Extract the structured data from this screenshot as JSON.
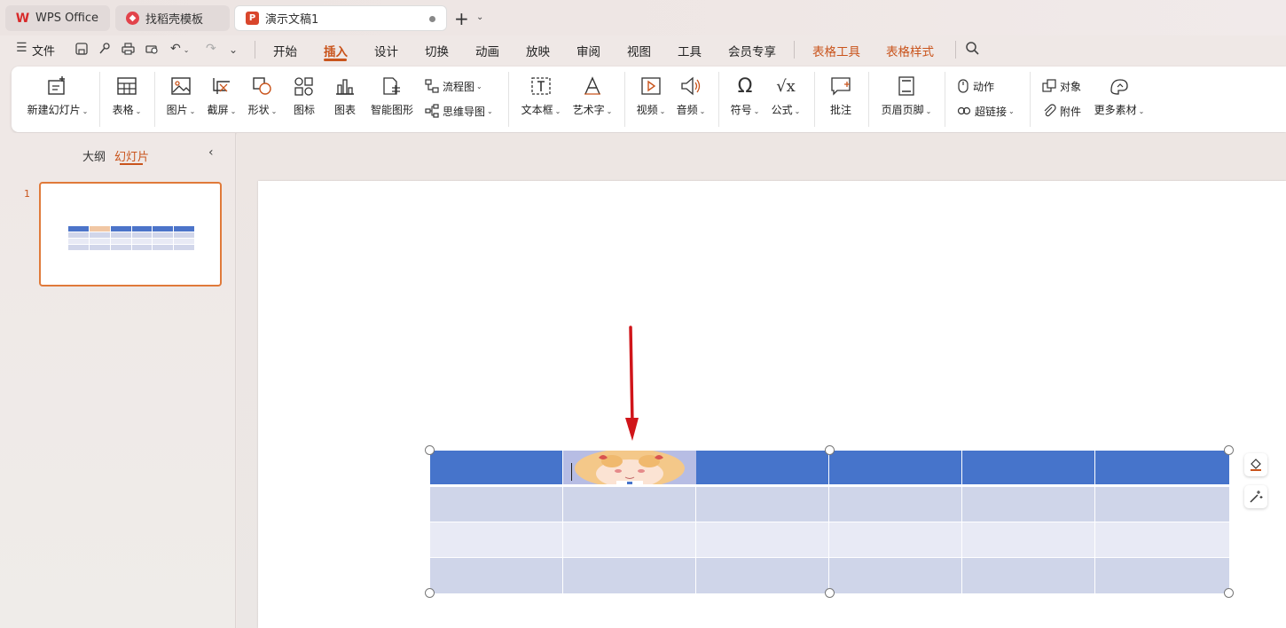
{
  "tabs": {
    "wps": "WPS Office",
    "templates": "找稻壳模板",
    "document": "演示文稿1"
  },
  "menu": {
    "file": "文件",
    "items": [
      "开始",
      "插入",
      "设计",
      "切换",
      "动画",
      "放映",
      "审阅",
      "视图",
      "工具",
      "会员专享"
    ],
    "context": [
      "表格工具",
      "表格样式"
    ],
    "active": "插入"
  },
  "ribbon": {
    "new_slide": "新建幻灯片",
    "table": "表格",
    "picture": "图片",
    "screenshot": "截屏",
    "shape": "形状",
    "icon": "图标",
    "chart": "图表",
    "smartart": "智能图形",
    "flowchart": "流程图",
    "mindmap": "思维导图",
    "textbox": "文本框",
    "wordart": "艺术字",
    "video": "视频",
    "audio": "音频",
    "symbol": "符号",
    "formula": "公式",
    "comment": "批注",
    "header_footer": "页眉页脚",
    "action": "动作",
    "hyperlink": "超链接",
    "object": "对象",
    "attachment": "附件",
    "more_materials": "更多素材"
  },
  "panel": {
    "outline": "大纲",
    "slides": "幻灯片",
    "slide_number": "1"
  },
  "colors": {
    "accent": "#c9541c",
    "table_header": "#4674cb",
    "table_band": "#cfd5e9",
    "table_band_alt": "#e8eaf5",
    "arrow": "#d0151a"
  }
}
